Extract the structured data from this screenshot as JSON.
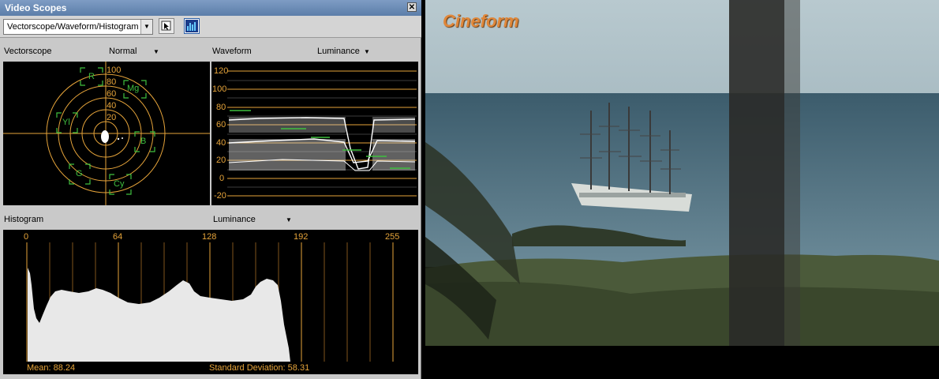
{
  "window": {
    "title": "Video Scopes",
    "close_glyph": "✕"
  },
  "toolbar": {
    "scope_select_value": "Vectorscope/Waveform/Histogram",
    "select_arrow": "▼",
    "cursor_button_icon": "pointer-icon",
    "histogram_toggle_icon": "histogram-icon"
  },
  "vectorscope": {
    "label": "Vectorscope",
    "mode": "Normal",
    "ring_labels": [
      "100",
      "80",
      "60",
      "40",
      "20"
    ],
    "targets": [
      "R",
      "Mg",
      "B",
      "Cy",
      "G",
      "Yl"
    ]
  },
  "waveform": {
    "label": "Waveform",
    "mode": "Luminance",
    "scale": [
      "120",
      "100",
      "80",
      "60",
      "40",
      "20",
      "0",
      "-20"
    ]
  },
  "histogram": {
    "label": "Histogram",
    "mode": "Luminance",
    "scale": [
      "0",
      "64",
      "128",
      "192",
      "255"
    ],
    "mean_text": "Mean: 88.24",
    "stddev_text": "Standard Deviation: 58.31"
  },
  "video": {
    "watermark": "Cineform"
  },
  "colors": {
    "scope_accent": "#e6a43a",
    "target_green": "#3fbf3f",
    "trace": "#e8e8e8"
  }
}
